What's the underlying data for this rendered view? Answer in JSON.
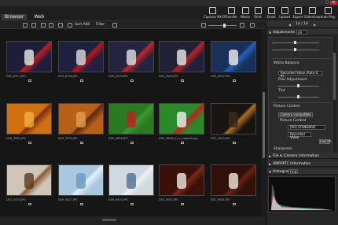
{
  "app": {
    "menu_tabs": [
      "Browser",
      "Web"
    ]
  },
  "toolbar_right": [
    {
      "label": "Capture NX-D",
      "icon": "capture-nxd-icon"
    },
    {
      "label": "Transfer",
      "icon": "transfer-icon"
    },
    {
      "label": "Movie",
      "icon": "movie-icon"
    },
    {
      "label": "Print",
      "icon": "print-icon"
    },
    {
      "label": "Email",
      "icon": "email-icon"
    },
    {
      "label": "Upload",
      "icon": "upload-icon"
    },
    {
      "label": "Export",
      "icon": "export-icon"
    },
    {
      "label": "Slideshow",
      "icon": "slideshow-icon"
    },
    {
      "label": "Auto Play",
      "icon": "autoplay-icon"
    }
  ],
  "toolbar": {
    "sort_label": "Sort ABC",
    "filter_label": "Filter"
  },
  "thumbnails": [
    {
      "caption": "DS9_6257.JPG",
      "colors": [
        "#1e1e3a",
        "#c02020",
        "#e8e8e8"
      ]
    },
    {
      "caption": "DS9_6258.JPG",
      "colors": [
        "#202040",
        "#b81818",
        "#dcdcdc"
      ]
    },
    {
      "caption": "DS9_6259.JPG",
      "colors": [
        "#242440",
        "#c82424",
        "#e0e0e0"
      ]
    },
    {
      "caption": "DS9_6260.JPG",
      "colors": [
        "#202038",
        "#c02020",
        "#e8e8e8"
      ]
    },
    {
      "caption": "DS9_6007.JPG",
      "colors": [
        "#18305a",
        "#2460c0",
        "#f0f0f0"
      ]
    },
    {
      "caption": "DS9_3985.JPG",
      "colors": [
        "#d07010",
        "#7a3010",
        "#f0b040"
      ]
    },
    {
      "caption": "DS9_3795.JPG",
      "colors": [
        "#b86018",
        "#5a2a10",
        "#e0a050"
      ]
    },
    {
      "caption": "DS9_3896.JPG",
      "colors": [
        "#2a7a20",
        "#3a9a30",
        "#c02020"
      ]
    },
    {
      "caption": "DS9_3898_0_m_cropped.jpg",
      "colors": [
        "#2a8a28",
        "#c02020",
        "#f0f0f0"
      ]
    },
    {
      "caption": "DS7_5345.JPG",
      "colors": [
        "#1a1410",
        "#b07020",
        "#3a2a18"
      ]
    },
    {
      "caption": "DS7_3376.JPG",
      "colors": [
        "#cfc6b8",
        "#8a5a30",
        "#5a3a20"
      ]
    },
    {
      "caption": "DS9_5017.JPG",
      "colors": [
        "#a8c8e0",
        "#e8f0f8",
        "#6898c0"
      ]
    },
    {
      "caption": "DS9_6005.JPG",
      "colors": [
        "#d0d8e0",
        "#f0f0f0",
        "#507090"
      ]
    },
    {
      "caption": "DS1_9552.JPG",
      "colors": [
        "#3a1008",
        "#7a2a18",
        "#f0e8e0"
      ]
    },
    {
      "caption": "DS1_9551.JPG",
      "colors": [
        "#301008",
        "#6a2014",
        "#f0e8e0"
      ]
    }
  ],
  "panel": {
    "nav_count": "14 / 14",
    "adjustments": {
      "title": "Adjustments",
      "preset": "All",
      "white_balance_label": "White Balance",
      "white_balance_value": "Recorded Value (Auto 0, 0)",
      "fine_adjustment": "Fine Adjustment",
      "tint_label": "Tint",
      "picture_control_label": "Picture Control",
      "camera_compatible": "Camera compatible",
      "picture_control_value": "[SD] STANDARD",
      "recorded_value": "Recorded Value",
      "launch_label": "Launch",
      "sharpness_label": "Sharpness"
    },
    "file_camera": "File & Camera Information",
    "xmp_iptc": "XMP/IPTC Information",
    "histogram": "Histogram",
    "histogram_mode": "RGB"
  }
}
